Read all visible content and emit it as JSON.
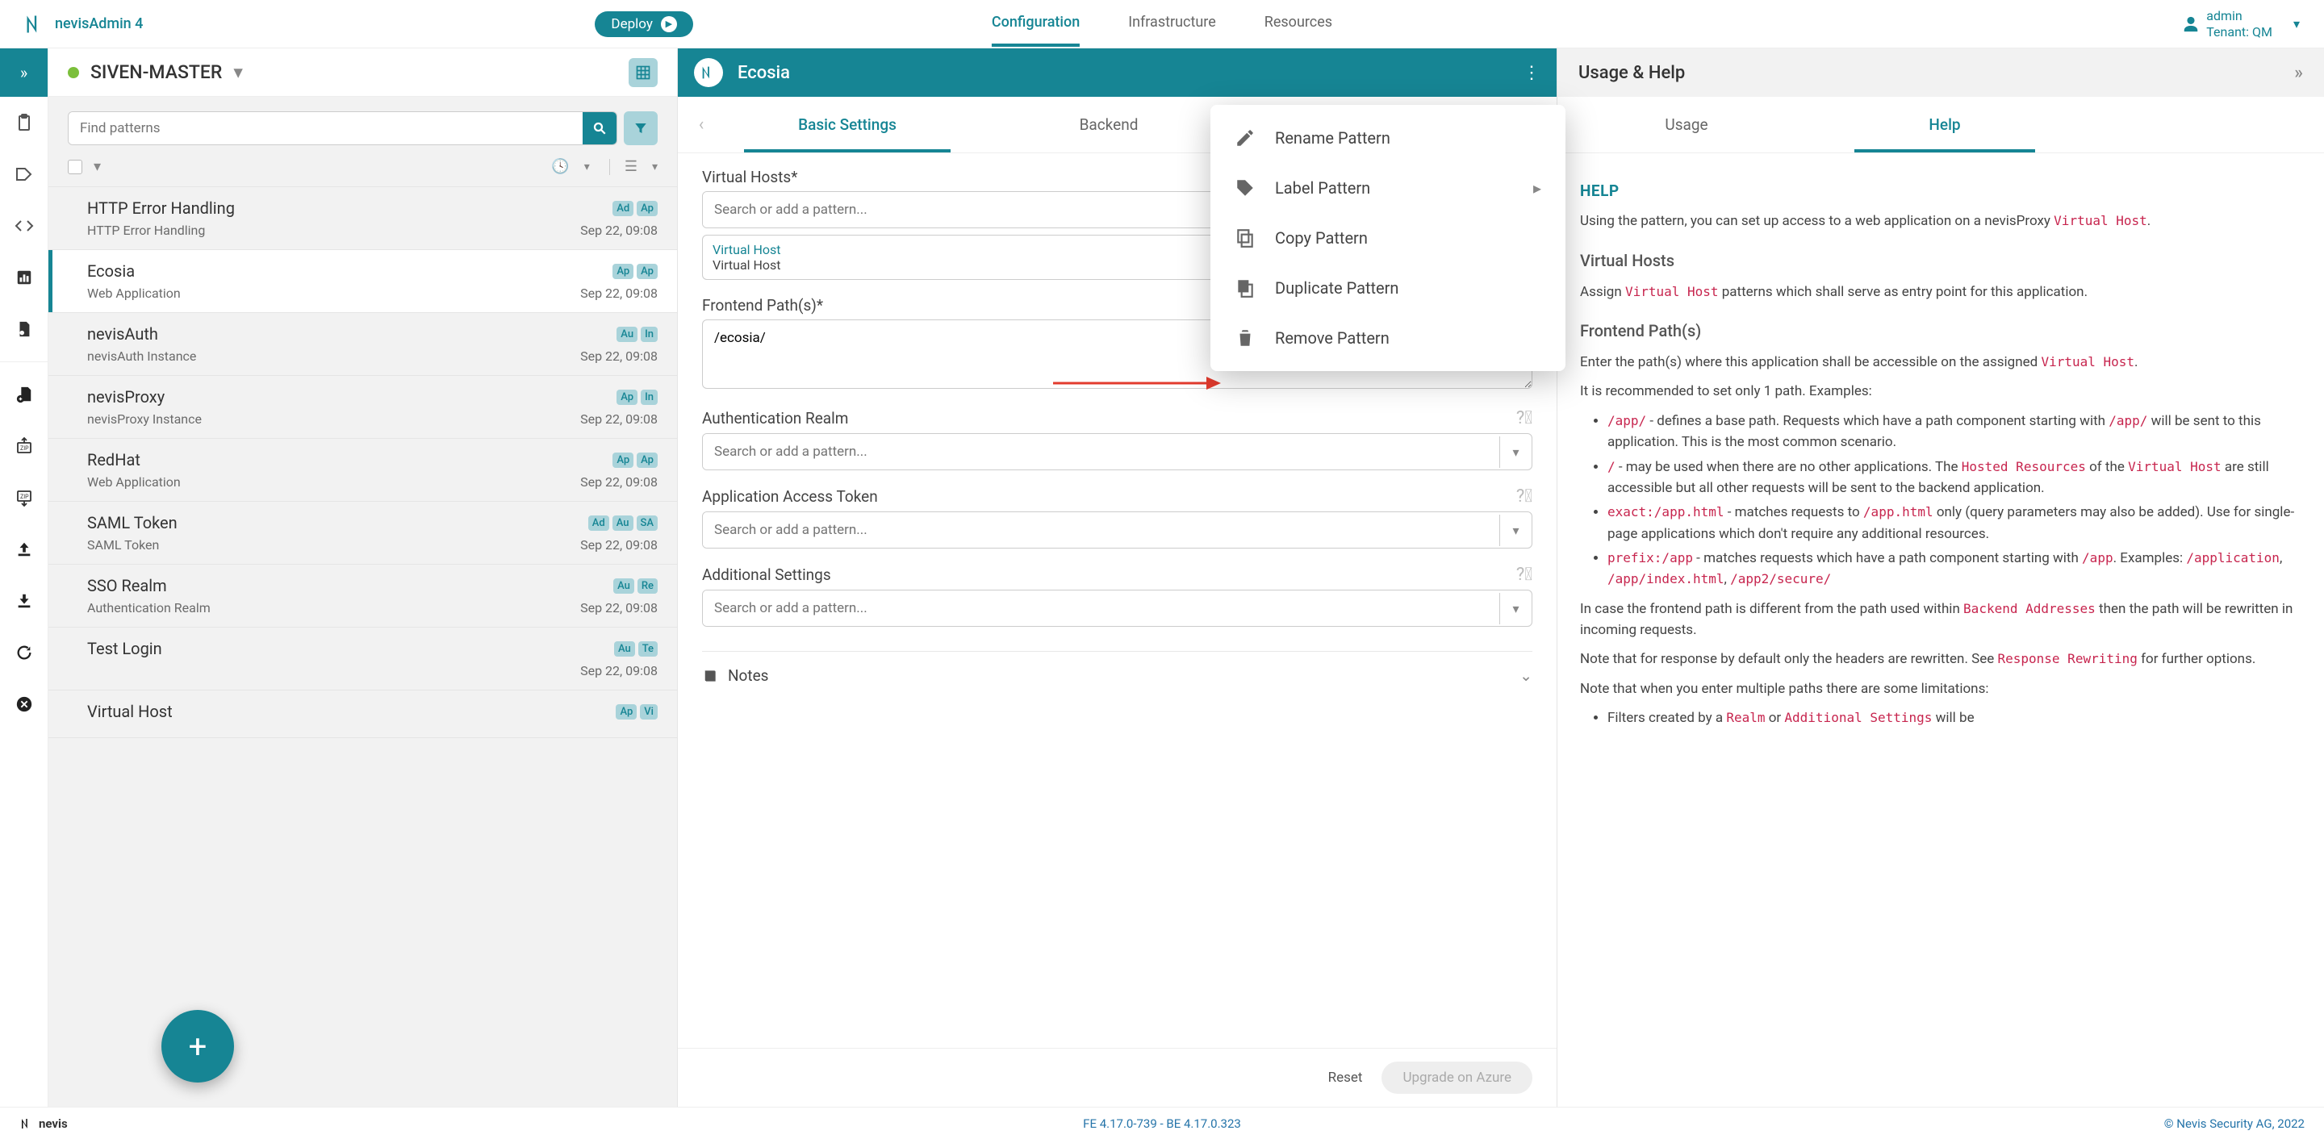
{
  "brand": "nevisAdmin 4",
  "topnav": {
    "configuration": "Configuration",
    "infrastructure": "Infrastructure",
    "resources": "Resources",
    "deploy": "Deploy"
  },
  "user": {
    "name": "admin",
    "tenant": "Tenant: QM"
  },
  "project": {
    "name": "SIVEN-MASTER",
    "search_placeholder": "Find patterns"
  },
  "patterns": [
    {
      "name": "HTTP Error Handling",
      "type": "HTTP Error Handling",
      "date": "Sep 22, 09:08",
      "b": [
        "Ad",
        "Ap"
      ]
    },
    {
      "name": "Ecosia",
      "type": "Web Application",
      "date": "Sep 22, 09:08",
      "b": [
        "Ap",
        "Ap"
      ]
    },
    {
      "name": "nevisAuth",
      "type": "nevisAuth Instance",
      "date": "Sep 22, 09:08",
      "b": [
        "Au",
        "In"
      ]
    },
    {
      "name": "nevisProxy",
      "type": "nevisProxy Instance",
      "date": "Sep 22, 09:08",
      "b": [
        "Ap",
        "In"
      ]
    },
    {
      "name": "RedHat",
      "type": "Web Application",
      "date": "Sep 22, 09:08",
      "b": [
        "Ap",
        "Ap"
      ]
    },
    {
      "name": "SAML Token",
      "type": "SAML Token",
      "date": "Sep 22, 09:08",
      "b": [
        "Ad",
        "Au",
        "SA"
      ]
    },
    {
      "name": "SSO Realm",
      "type": "Authentication Realm",
      "date": "Sep 22, 09:08",
      "b": [
        "Au",
        "Re"
      ]
    },
    {
      "name": "Test Login",
      "type": "",
      "date": "Sep 22, 09:08",
      "b": [
        "Au",
        "Te"
      ]
    },
    {
      "name": "Virtual Host",
      "type": "",
      "date": "",
      "b": [
        "Ap",
        "Vi"
      ]
    }
  ],
  "selected_index": 1,
  "editor": {
    "title": "Ecosia",
    "tabs": {
      "basic": "Basic Settings",
      "backend": "Backend"
    },
    "labels": {
      "virtual_hosts": "Virtual Hosts*",
      "frontend_paths": "Frontend Path(s)*",
      "auth_realm": "Authentication Realm",
      "access_token": "Application Access Token",
      "additional": "Additional Settings",
      "notes": "Notes"
    },
    "placeholder": "Search or add a pattern...",
    "vh_chip": {
      "title": "Virtual Host",
      "sub": "Virtual Host"
    },
    "frontend_value": "/ecosia/",
    "reset": "Reset",
    "azure": "Upgrade on Azure"
  },
  "ctxmenu": {
    "rename": "Rename Pattern",
    "label": "Label Pattern",
    "copy": "Copy Pattern",
    "duplicate": "Duplicate Pattern",
    "remove": "Remove Pattern"
  },
  "rightpanel": {
    "header": "Usage & Help",
    "tabs": {
      "usage": "Usage",
      "help": "Help"
    }
  },
  "help": {
    "title": "HELP",
    "intro_a": "Using the pattern, you can set up access to a web application on a nevisProxy ",
    "intro_code": "Virtual Host",
    "h_vh": "Virtual Hosts",
    "vh_a": "Assign ",
    "vh_code": "Virtual Host",
    "vh_b": " patterns which shall serve as entry point for this application.",
    "h_fp": "Frontend Path(s)",
    "fp_a": "Enter the path(s) where this application shall be accessible on the assigned ",
    "fp_code": "Virtual Host",
    "fp_rec": "It is recommended to set only 1 path. Examples:",
    "li1_code": "/app/",
    "li1_t": " - defines a base path. Requests which have a path component starting with ",
    "li1_code2": "/app/",
    "li1_t2": " will be sent to this application. This is the most common scenario.",
    "li2_code": "/",
    "li2_t": " - may be used when there are no other applications. The ",
    "li2_code2": "Hosted Resources",
    "li2_t2": " of the ",
    "li2_code3": "Virtual Host",
    "li2_t3": " are still accessible but all other requests will be sent to the backend application.",
    "li3_code": "exact:/app.html",
    "li3_t": " - matches requests to ",
    "li3_code2": "/app.html",
    "li3_t2": " only (query parameters may also be added). Use for single-page applications which don't require any additional resources.",
    "li4_code": "prefix:/app",
    "li4_t": " - matches requests which have a path component starting with ",
    "li4_code2": "/app",
    "li4_t2": ". Examples: ",
    "li4_code3": "/application",
    "li4_t3": ", ",
    "li4_code4": "/app/index.html",
    "li4_t4": ", ",
    "li4_code5": "/app2/secure/",
    "p2_a": "In case the frontend path is different from the path used within ",
    "p2_code": "Backend Addresses",
    "p2_b": " then the path will be rewritten in incoming requests.",
    "p3_a": "Note that for response by default only the headers are rewritten. See ",
    "p3_code": "Response Rewriting",
    "p3_b": " for further options.",
    "p4": "Note that when you enter multiple paths there are some limitations:",
    "li5_a": "Filters created by a ",
    "li5_code": "Realm",
    "li5_b": " or ",
    "li5_code2": "Additional Settings",
    "li5_c": " will be"
  },
  "footer": {
    "brand": "nevis",
    "version": "FE 4.17.0-739 - BE 4.17.0.323",
    "copyright": "© Nevis Security AG, 2022"
  }
}
